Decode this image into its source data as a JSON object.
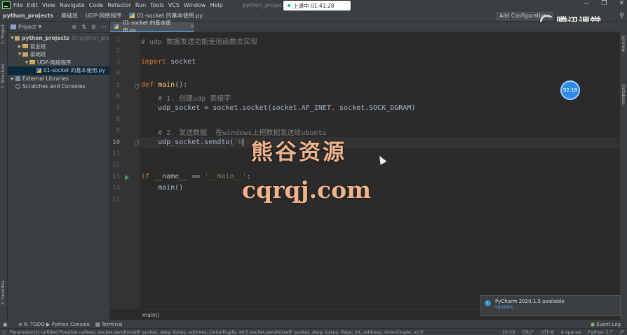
{
  "menubar": {
    "items": [
      "File",
      "Edit",
      "View",
      "Navigate",
      "Code",
      "Refactor",
      "Run",
      "Tools",
      "VCS",
      "Window",
      "Help"
    ],
    "window_title": "python_projects - 01-so...",
    "rec_text": "上课中 01:41:28"
  },
  "navbar": {
    "crumbs": [
      "python_projects",
      "基础班",
      "UDP-网络程序",
      "01-socket 的基本使用.py"
    ],
    "add_config": "Add Configuration..."
  },
  "branding": {
    "text": "腾讯课堂"
  },
  "left_strip": {
    "project_tab": "1: Project",
    "structure_tab": "7: Structure",
    "favorites_tab": "2: Favorites"
  },
  "project_panel": {
    "title": "Project",
    "tree": [
      {
        "label": "python_projects",
        "path": "D:\\python_pro",
        "indent": 0,
        "type": "folder",
        "expanded": true
      },
      {
        "label": "就业班",
        "indent": 1,
        "type": "folder",
        "expanded": false
      },
      {
        "label": "基础班",
        "indent": 1,
        "type": "folder",
        "expanded": true
      },
      {
        "label": "UDP-网络程序",
        "indent": 2,
        "type": "folder",
        "expanded": true
      },
      {
        "label": "01-socket 的基本使用.py",
        "indent": 3,
        "type": "pyfile",
        "selected": true
      },
      {
        "label": "External Libraries",
        "indent": 0,
        "type": "lib",
        "expanded": false
      },
      {
        "label": "Scratches and Consoles",
        "indent": 0,
        "type": "scratch"
      }
    ]
  },
  "editor": {
    "tab_label": "01-socket 的基本使用.py",
    "line_numbers": [
      "1",
      "2",
      "3",
      "4",
      "5",
      "6",
      "7",
      "8",
      "9",
      "10",
      "11",
      "12",
      "13",
      "14",
      "15"
    ],
    "current_line": "10",
    "line1": "# udp 数据发送功能使用函数去实现",
    "line3_kw": "import",
    "line3_rest": " socket",
    "line5_kw": "def ",
    "line5_fn": "main",
    "line5_rest": "():",
    "line6": "    # 1. 创建udp 套接字",
    "line7_a": "    udp_socket = socket.socket(socket.AF_INET",
    "line7_b": ", ",
    "line7_c": "socket.SOCK_DGRAM)",
    "line9": "    # 2. 发送数据  在windows上把数据发送给ubuntu",
    "line10_a": "    udp_socket.sendto(",
    "line10_b": "'h",
    "line13_kw": "if",
    "line13_rest": " __name__ == ",
    "line13_str": "'__main__'",
    "line13_colon": ":",
    "line14": "    main()",
    "bottom_crumb": "main()"
  },
  "overlay": {
    "watermark_cn": "熊谷资源",
    "watermark_url": "cqrqj.com",
    "timer": "92:18"
  },
  "notification": {
    "title": "PyCharm 2020.1.5 available",
    "link": "Update..."
  },
  "tools": {
    "todo": "6: TODO",
    "console": "Python Console",
    "terminal": "Terminal",
    "event_log": "Event Log"
  },
  "status": {
    "message": "Parameter(s) unfilled Possible callees: socket.sendto(self: socket, data: bytes, address: Union[tuple, str]) socket.sendto(self: socket, data: bytes, flags: int, address: Union[tuple, str])",
    "position": "10:29",
    "line_sep": "CRLF",
    "encoding": "UTF-8",
    "indent": "4 spaces",
    "interpreter": "Python 3.7"
  },
  "colors": {
    "accent": "#4a88c7",
    "keyword": "#cc7832",
    "string": "#6a8759",
    "comment": "#808080",
    "function": "#ffc66d"
  }
}
